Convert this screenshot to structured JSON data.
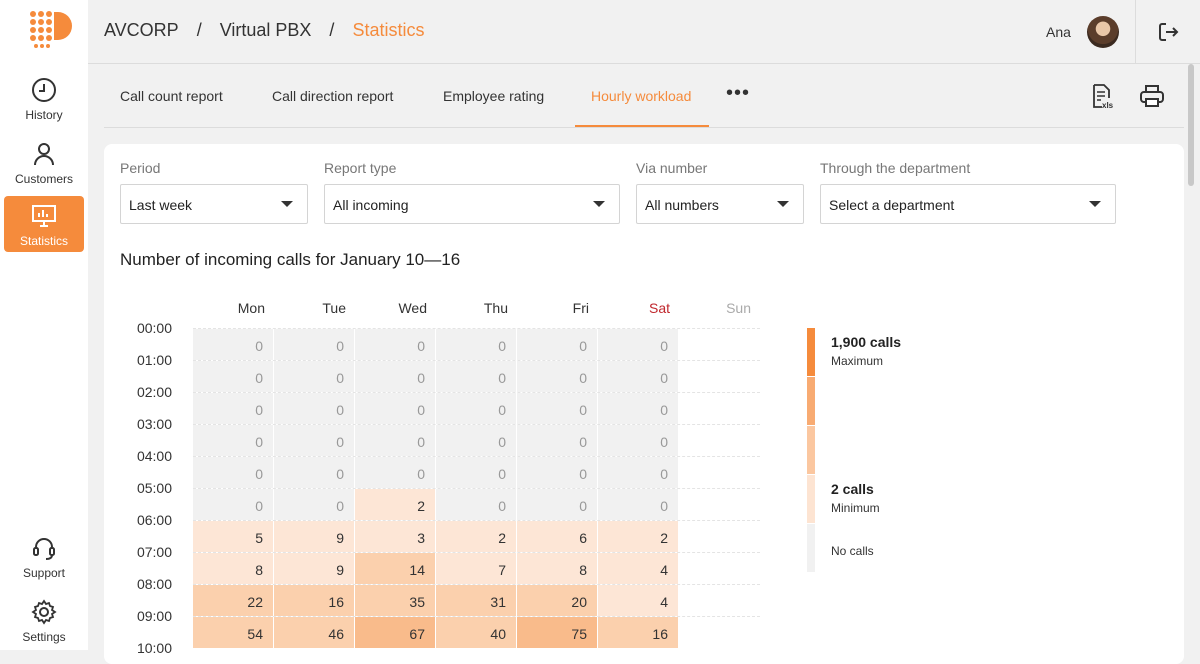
{
  "sidebar": {
    "items": [
      {
        "label": "History",
        "icon": "clock-icon"
      },
      {
        "label": "Customers",
        "icon": "person-icon"
      },
      {
        "label": "Statistics",
        "icon": "presentation-chart-icon"
      },
      {
        "label": "Support",
        "icon": "headset-icon"
      },
      {
        "label": "Settings",
        "icon": "gear-icon"
      }
    ],
    "active_index": 2,
    "accent": "#f58b3c"
  },
  "header": {
    "breadcrumb": [
      "AVCORP",
      "Virtual PBX",
      "Statistics"
    ],
    "user_name": "Ana"
  },
  "tabs": [
    {
      "label": "Call count report"
    },
    {
      "label": "Call direction report"
    },
    {
      "label": "Employee rating"
    },
    {
      "label": "Hourly workload"
    }
  ],
  "active_tab": 3,
  "filters": {
    "period": {
      "label": "Period",
      "value": "Last week"
    },
    "report_type": {
      "label": "Report type",
      "value": "All incoming"
    },
    "via_number": {
      "label": "Via number",
      "value": "All numbers"
    },
    "department": {
      "label": "Through the department",
      "value": "Select a department"
    }
  },
  "report": {
    "title": "Number of incoming calls for January 10—16",
    "days": [
      "Mon",
      "Tue",
      "Wed",
      "Thu",
      "Fri",
      "Sat",
      "Sun"
    ],
    "hours": [
      "00:00",
      "01:00",
      "02:00",
      "03:00",
      "04:00",
      "05:00",
      "06:00",
      "07:00",
      "08:00",
      "09:00",
      "10:00"
    ],
    "rows": [
      [
        "0",
        "0",
        "0",
        "0",
        "0",
        "0"
      ],
      [
        "0",
        "0",
        "0",
        "0",
        "0",
        "0"
      ],
      [
        "0",
        "0",
        "0",
        "0",
        "0",
        "0"
      ],
      [
        "0",
        "0",
        "0",
        "0",
        "0",
        "0"
      ],
      [
        "0",
        "0",
        "0",
        "0",
        "0",
        "0"
      ],
      [
        "0",
        "0",
        "2",
        "0",
        "0",
        "0"
      ],
      [
        "5",
        "9",
        "3",
        "2",
        "6",
        "2"
      ],
      [
        "8",
        "9",
        "14",
        "7",
        "8",
        "4"
      ],
      [
        "22",
        "16",
        "35",
        "31",
        "20",
        "4"
      ],
      [
        "54",
        "46",
        "67",
        "40",
        "75",
        "16"
      ]
    ]
  },
  "legend": {
    "max_value": "1,900 calls",
    "max_label": "Maximum",
    "min_value": "2 calls",
    "min_label": "Minimum",
    "none_label": "No calls",
    "colors": [
      "#f58b3c",
      "#f8ab72",
      "#fbc7a0",
      "#fde4d2",
      "#f1f1f1"
    ]
  }
}
